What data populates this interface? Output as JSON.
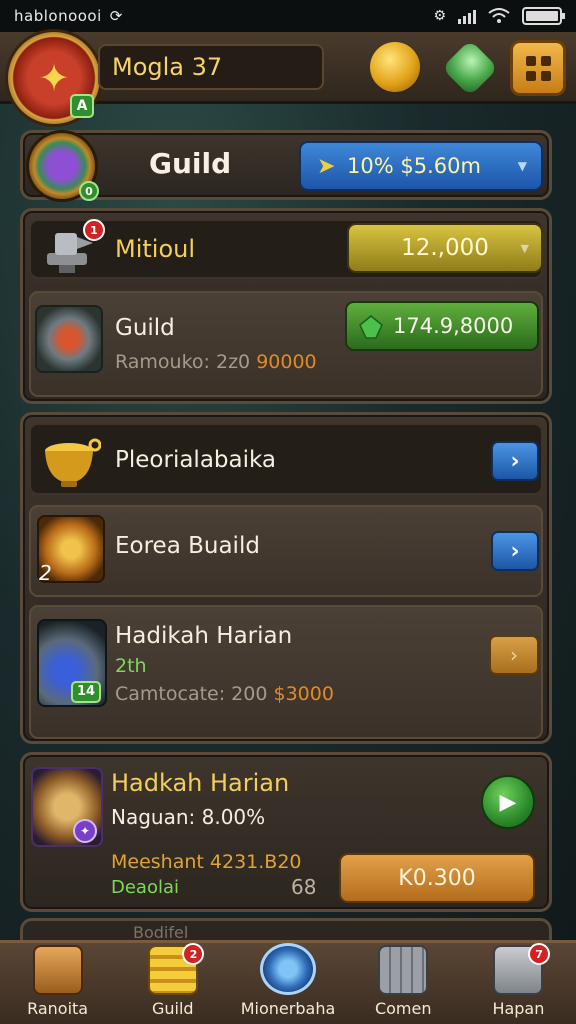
{
  "status_bar": {
    "carrier": "hablonoooi",
    "extra_icon": "sync-icon"
  },
  "header": {
    "level_badge": "A",
    "player_name": "Mogla 37"
  },
  "guild_banner": {
    "title": "Guild",
    "crest_level": "0",
    "currency_value": "10% $5.60m"
  },
  "rows": {
    "r1": {
      "title": "Mitioul",
      "badge": "1",
      "value": "12.,000"
    },
    "r2": {
      "title": "Guild",
      "subtitle_label": "Ramouko: 2z0",
      "subtitle_value": "90000",
      "value": "174.9,8000"
    },
    "r3": {
      "title": "Pleorialabaika"
    },
    "r4": {
      "title": "Eorea Buaild",
      "corner_number": "2"
    },
    "r5": {
      "title": "Hadikah Harian",
      "level": "2th",
      "icon_level": "14",
      "subtitle_label": "Camtocate: 200",
      "subtitle_value": "$3000"
    },
    "r6": {
      "title": "Hadkah Harian",
      "subtitle": "Naguan: 8.00%",
      "info_line": "Meeshant 4231.B20",
      "info_extra": "Deaolai",
      "info_count": "68",
      "buy_label": "K0.300"
    },
    "r7": {
      "title": "Bodifel"
    }
  },
  "nav": [
    {
      "label": "Ranoita",
      "badge": ""
    },
    {
      "label": "Guild",
      "badge": "2"
    },
    {
      "label": "Mionerbaha",
      "badge": ""
    },
    {
      "label": "Comen",
      "badge": ""
    },
    {
      "label": "Hapan",
      "badge": "7"
    }
  ],
  "colors": {
    "accent_gold": "#f3cf58",
    "primary_blue": "#2f6fc4",
    "success_green": "#3f8f2c",
    "alert_red": "#d32222"
  }
}
